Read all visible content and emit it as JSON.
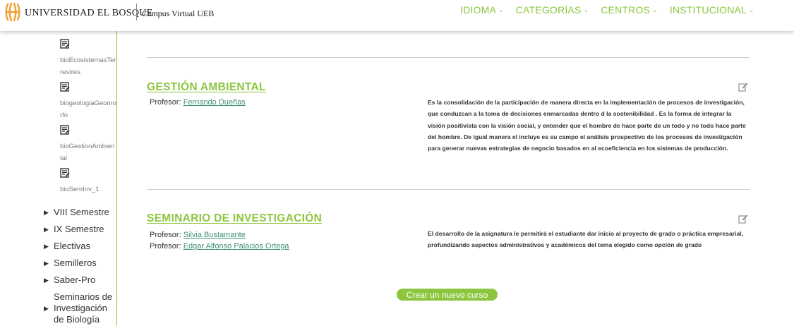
{
  "header": {
    "brand_name": "UNIVERSIDAD EL BOSQUE",
    "campus_label": "Campus Virtual UEB",
    "colors": {
      "accent": "#8cc63f",
      "logo": "#f0a030"
    },
    "nav": [
      {
        "label": "IDIOMA",
        "icon": "chevron-down-icon"
      },
      {
        "label": "CATEGORÍAS",
        "icon": "chevron-down-icon"
      },
      {
        "label": "CENTROS",
        "icon": "chevron-down-icon"
      },
      {
        "label": "INSTITUCIONAL",
        "icon": "chevron-down-icon"
      }
    ]
  },
  "sidebar": {
    "documents": [
      {
        "label": "bioEcosistemasTerrestres",
        "icon": "document-icon"
      },
      {
        "label": "biogeologiaGeomorfo",
        "icon": "document-icon"
      },
      {
        "label": "bioGestionAmbiental",
        "icon": "document-icon"
      },
      {
        "label": "bioSemInv_1",
        "icon": "document-icon"
      }
    ],
    "folders": [
      {
        "label": "VIII Semestre",
        "icon": "expand-triangle-icon"
      },
      {
        "label": "IX Semestre",
        "icon": "expand-triangle-icon"
      },
      {
        "label": "Electivas",
        "icon": "expand-triangle-icon"
      },
      {
        "label": "Semilleros",
        "icon": "expand-triangle-icon"
      },
      {
        "label": "Saber-Pro",
        "icon": "expand-triangle-icon"
      },
      {
        "label": "Seminarios de Investigación de Biología",
        "icon": "expand-triangle-icon"
      }
    ]
  },
  "courses": [
    {
      "title": "GESTIÓN AMBIENTAL",
      "teacher_role": "Profesor:",
      "teachers": [
        "Fernando Dueñas"
      ],
      "summary": "Es la consolidación de la participación de manera directa en la implementación de procesos de investigación, que conduzcan a la toma de decisiones enmarcadas dentro d la sostenibilidad . Es la forma de integrar la visión positivista con la visión social, y entender que el hombre de hace parte de un todo y no todo hace parte del hombre. De igual manera el incluye es su campo el análisis prospectivo de los procesos de investigación para generar nuevas estrategias de negocio basados en al ecoeficiencia en los sistemas de producción."
    },
    {
      "title": "SEMINARIO DE INVESTIGACIÓN",
      "teacher_role": "Profesor:",
      "teachers": [
        "Silvia Bustamante",
        "Edgar Alfonso Palacios Ortega"
      ],
      "summary": "El desarrollo de la asignatura le permitirá  el estudiante dar inicio al proyecto de grado o práctica empresarial,  profundizando aspectos administrativos y académicos del tema elegido  como opción de grado"
    }
  ],
  "actions": {
    "new_course_label": "Crear un nuevo curso"
  }
}
